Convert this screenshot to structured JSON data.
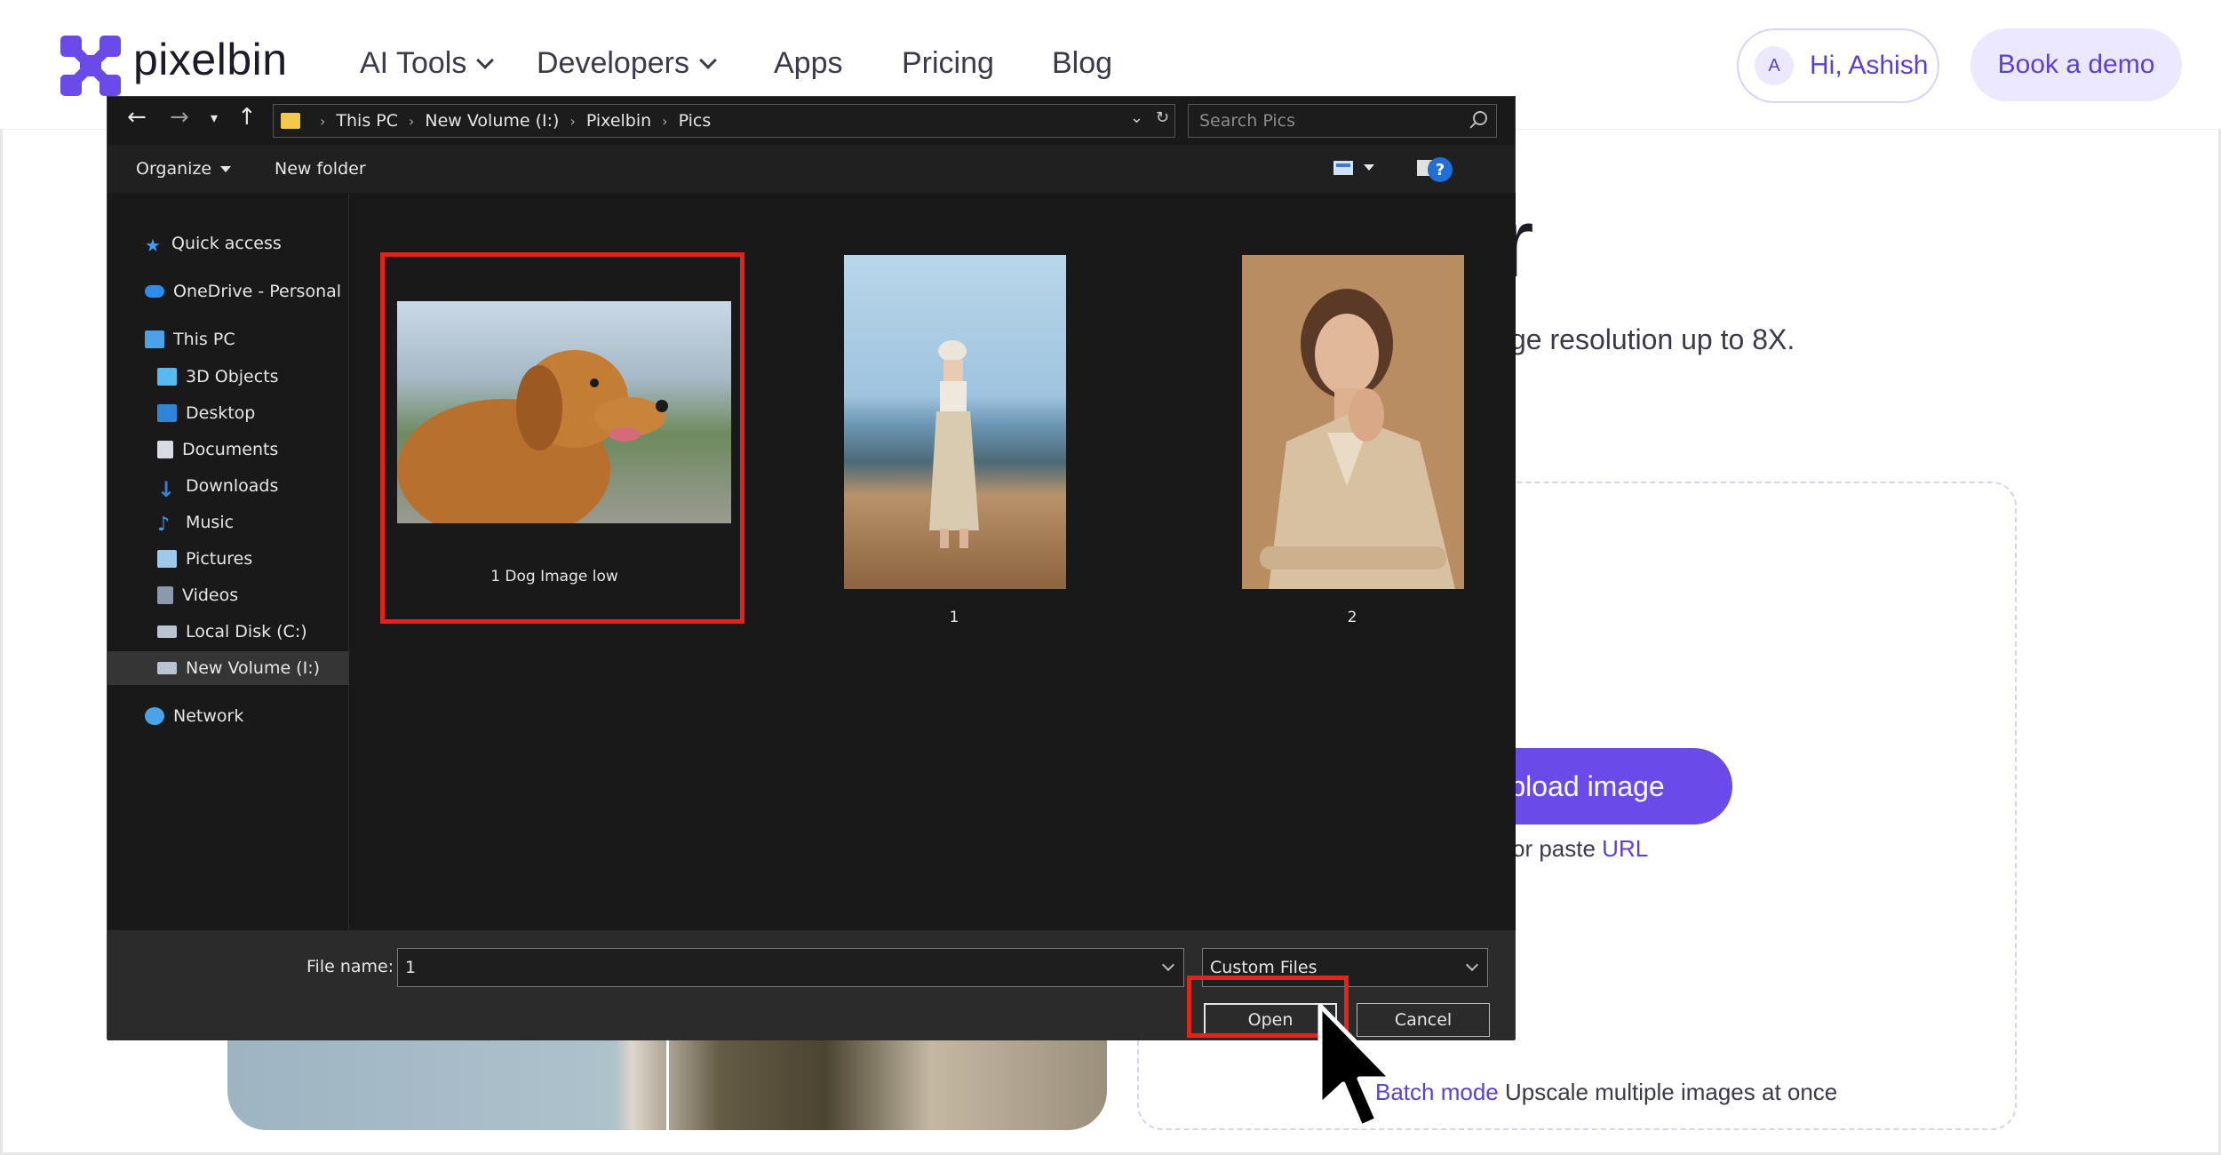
{
  "site": {
    "logo_text": "pixelbin",
    "nav": {
      "ai_tools": "AI Tools",
      "developers": "Developers",
      "apps": "Apps",
      "pricing": "Pricing",
      "blog": "Blog"
    },
    "user": {
      "initial": "A",
      "greeting": "Hi, Ashish"
    },
    "book_demo": "Book a demo",
    "hero_title_tail": "r",
    "hero_subtitle_tail": "ge resolution up to 8X.",
    "upload_button": "Upload image",
    "paste_prefix": "or paste ",
    "paste_link": "URL",
    "batch_link": "Batch mode",
    "batch_text": " Upscale multiple images at once",
    "colors": {
      "brand": "#6a4ae8",
      "brand_light": "#ece8ff",
      "highlight": "#e5231b"
    }
  },
  "dialog": {
    "breadcrumb": [
      "This PC",
      "New Volume (I:)",
      "Pixelbin",
      "Pics"
    ],
    "search_placeholder": "Search Pics",
    "toolbar": {
      "organize": "Organize",
      "new_folder": "New folder",
      "help": "?"
    },
    "nav_items": {
      "quick_access": "Quick access",
      "onedrive": "OneDrive - Personal",
      "this_pc": "This PC",
      "objects3d": "3D Objects",
      "desktop": "Desktop",
      "documents": "Documents",
      "downloads": "Downloads",
      "music": "Music",
      "pictures": "Pictures",
      "videos": "Videos",
      "local_disk": "Local Disk (C:)",
      "new_volume": "New Volume (I:)",
      "network": "Network"
    },
    "files": [
      {
        "name": "1 Dog Image low"
      },
      {
        "name": "1"
      },
      {
        "name": "2"
      }
    ],
    "file_name_label": "File name:",
    "file_name_value": "1",
    "file_type": "Custom Files",
    "open_button": "Open",
    "cancel_button": "Cancel"
  }
}
